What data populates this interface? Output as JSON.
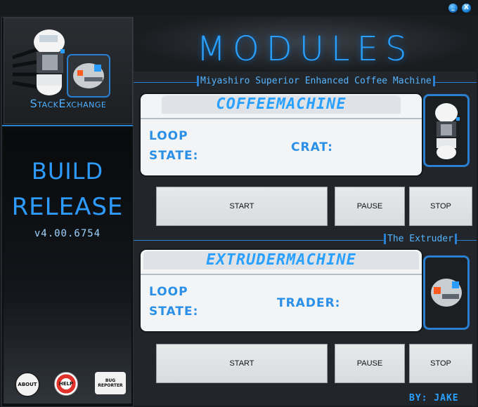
{
  "window": {
    "minimize_label": "_",
    "close_label": "X"
  },
  "sidebar": {
    "logo_text": "StackExchange",
    "build_line1": "BUILD",
    "build_line2": "RELEASE",
    "version": "v4.00.6754",
    "about_label": "ABOUT",
    "help_label": "HELP",
    "bug_label": "BUG REPORTER"
  },
  "header": {
    "title": "MODULES"
  },
  "modules": [
    {
      "tag": "Miyashiro Superior Enhanced Coffee Machine",
      "name": "COFFEEMACHINE",
      "loop_label": "LOOP",
      "state_label": "STATE:",
      "extra_label": "CRAT:",
      "start_label": "START",
      "pause_label": "PAUSE",
      "stop_label": "STOP"
    },
    {
      "tag": "The Extruder",
      "name": "EXTRUDERMACHINE",
      "loop_label": "LOOP",
      "state_label": "STATE:",
      "extra_label": "TRADER:",
      "start_label": "START",
      "pause_label": "PAUSE",
      "stop_label": "STOP"
    }
  ],
  "footer": {
    "credit": "BY: JAKE"
  },
  "colors": {
    "accent": "#2aa0ff",
    "panel": "#f3f4f5",
    "background": "#22262a"
  }
}
